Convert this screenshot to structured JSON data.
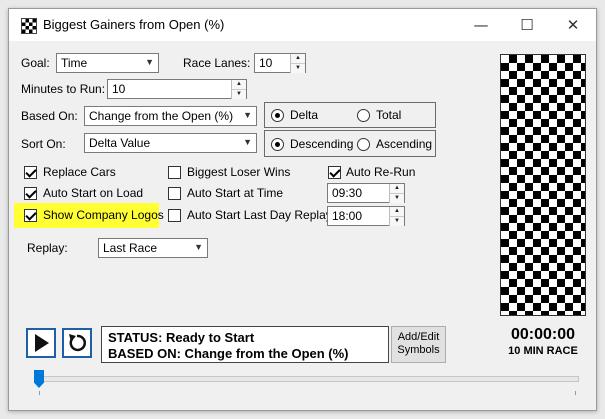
{
  "window": {
    "title": "Biggest Gainers from Open (%)",
    "minimize_icon": "minimize-icon",
    "maximize_icon": "maximize-icon",
    "close_icon": "close-icon"
  },
  "form": {
    "goal_label": "Goal:",
    "goal_value": "Time",
    "race_lanes_label": "Race Lanes:",
    "race_lanes_value": "10",
    "minutes_label": "Minutes to Run:",
    "minutes_value": "10",
    "based_on_label": "Based On:",
    "based_on_value": "Change from the Open (%)",
    "delta_label": "Delta",
    "total_label": "Total",
    "sort_on_label": "Sort On:",
    "sort_on_value": "Delta Value",
    "descending_label": "Descending",
    "ascending_label": "Ascending",
    "replay_label": "Replay:",
    "replay_value": "Last Race"
  },
  "checks": {
    "replace_cars": "Replace Cars",
    "auto_start_on_load": "Auto Start on Load",
    "show_company_logos": "Show Company Logos",
    "biggest_loser_wins": "Biggest Loser Wins",
    "auto_start_at_time": "Auto Start at Time",
    "auto_start_last_day_replay": "Auto Start Last Day Replay",
    "auto_rerun": "Auto Re-Run",
    "auto_start_time_value": "09:30",
    "replay_time_value": "18:00"
  },
  "status": {
    "line1": "STATUS: Ready to Start",
    "line2": "BASED ON: Change from the Open (%)",
    "add_edit_line1": "Add/Edit",
    "add_edit_line2": "Symbols",
    "timer": "00:00:00",
    "race_length": "10 MIN RACE"
  },
  "colors": {
    "highlight": "#ffff33",
    "accent": "#1f5fa8",
    "slider": "#0078d7"
  }
}
